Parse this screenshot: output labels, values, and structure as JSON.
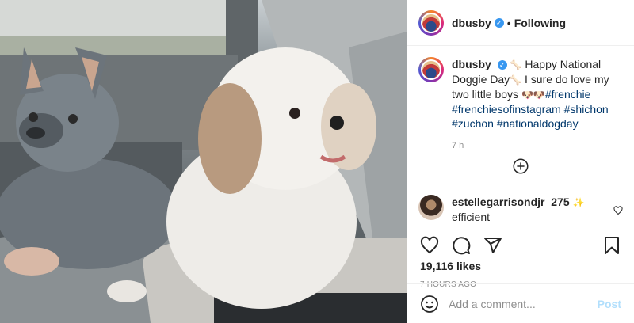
{
  "header": {
    "username": "dbusby",
    "separator": "•",
    "follow_status": "Following"
  },
  "caption": {
    "username": "dbusby",
    "text_1": "Happy National Doggie Day",
    "text_2": "I sure do love my two little boys",
    "hashtags": [
      "#frenchie",
      "#frenchiesofinstagram",
      "#shichon",
      "#zuchon",
      "#nationaldogday"
    ],
    "time": "7 h"
  },
  "comment": {
    "username": "estellegarrisondjr_275",
    "text": "efficient"
  },
  "likes": "19,116 likes",
  "date": "7 HOURS AGO",
  "add_comment": {
    "placeholder": "Add a comment...",
    "post_label": "Post"
  },
  "colors": {
    "verified": "#3897f0",
    "hashtag": "#00376b",
    "post_button": "#b2dffc",
    "muted_text": "#8e8e8e"
  },
  "icons": [
    "verified-badge-icon",
    "bone-icon",
    "dog-face-icon",
    "load-more-icon",
    "heart-icon",
    "comment-icon",
    "share-icon",
    "bookmark-icon",
    "emoji-icon",
    "comment-like-heart-icon"
  ]
}
